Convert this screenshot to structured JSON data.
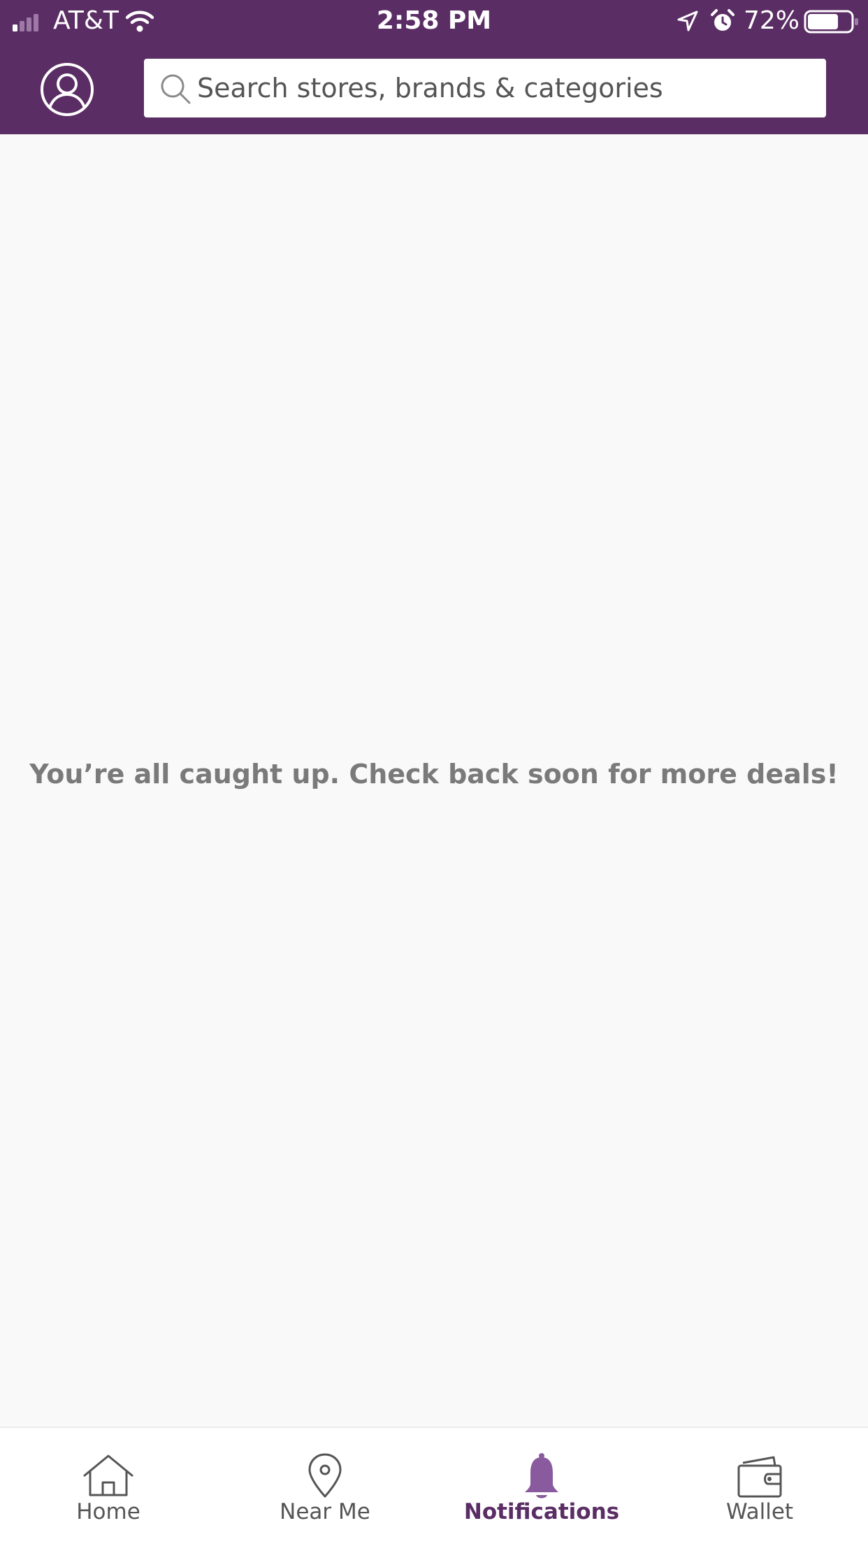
{
  "status_bar": {
    "carrier": "AT&T",
    "time": "2:58 PM",
    "battery_percent": "72%",
    "battery_level": 0.72,
    "icons": [
      "signal-icon",
      "wifi-icon",
      "location-arrow-icon",
      "alarm-icon",
      "battery-icon"
    ]
  },
  "header": {
    "profile_icon": "user-circle-icon",
    "search": {
      "placeholder": "Search stores, brands & categories",
      "value": "",
      "icon": "search-icon"
    }
  },
  "main": {
    "empty_message": "You’re all caught up. Check back soon for more deals!"
  },
  "tab_bar": {
    "tabs": [
      {
        "label": "Home",
        "icon": "house-icon",
        "active": false
      },
      {
        "label": "Near Me",
        "icon": "map-pin-icon",
        "active": false
      },
      {
        "label": "Notifications",
        "icon": "bell-icon",
        "active": true
      },
      {
        "label": "Wallet",
        "icon": "wallet-icon",
        "active": false
      }
    ]
  },
  "colors": {
    "brand_purple": "#5b2d65",
    "active_icon": "#8a5a9e",
    "background": "#f9f9f9",
    "message_text": "#7a7a7a",
    "tab_label": "#555555"
  }
}
